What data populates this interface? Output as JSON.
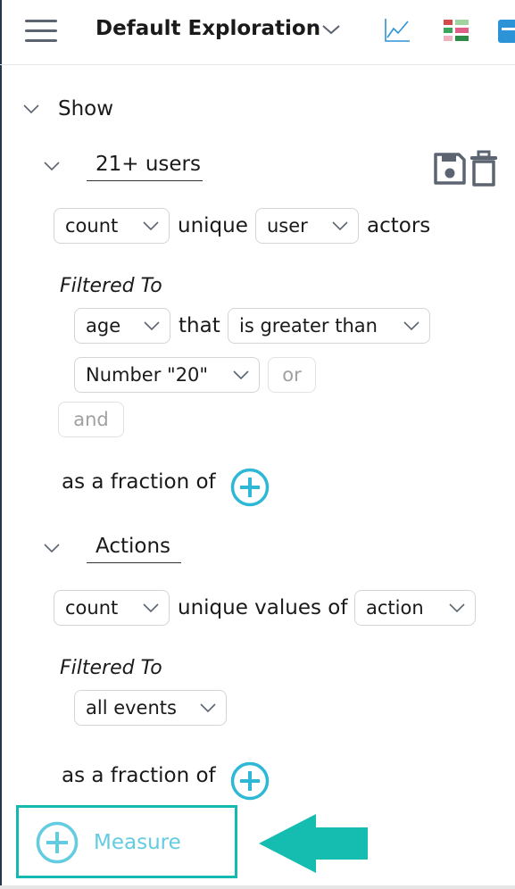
{
  "header": {
    "title": "Default Exploration",
    "menu_icon": "hamburger-menu-icon",
    "icons": [
      "chevron-down-icon",
      "line-chart-icon",
      "grid-view-icon",
      "table-icon"
    ]
  },
  "show": {
    "label": "Show"
  },
  "measures": [
    {
      "name": "21+ users",
      "aggregation": "count",
      "middle_text": "unique",
      "entity": "user",
      "suffix": "actors",
      "filtered_to_label": "Filtered To",
      "filter": {
        "property": "age",
        "connector": "that",
        "operator": "is greater than",
        "value": "Number \"20\"",
        "or_label": "or",
        "and_label": "and"
      },
      "fraction_label": "as a fraction of"
    },
    {
      "name": "Actions",
      "aggregation": "count",
      "middle_text": "unique values of",
      "property": "action",
      "filtered_to_label": "Filtered To",
      "filter_value": "all events",
      "fraction_label": "as a fraction of"
    }
  ],
  "add_measure": {
    "label": "Measure"
  },
  "colors": {
    "accent": "#2eb8d6",
    "highlight": "#14b9b0",
    "measure_text": "#63cce0",
    "icon_gray": "#5b6470",
    "arrow": "#14bdb0"
  }
}
